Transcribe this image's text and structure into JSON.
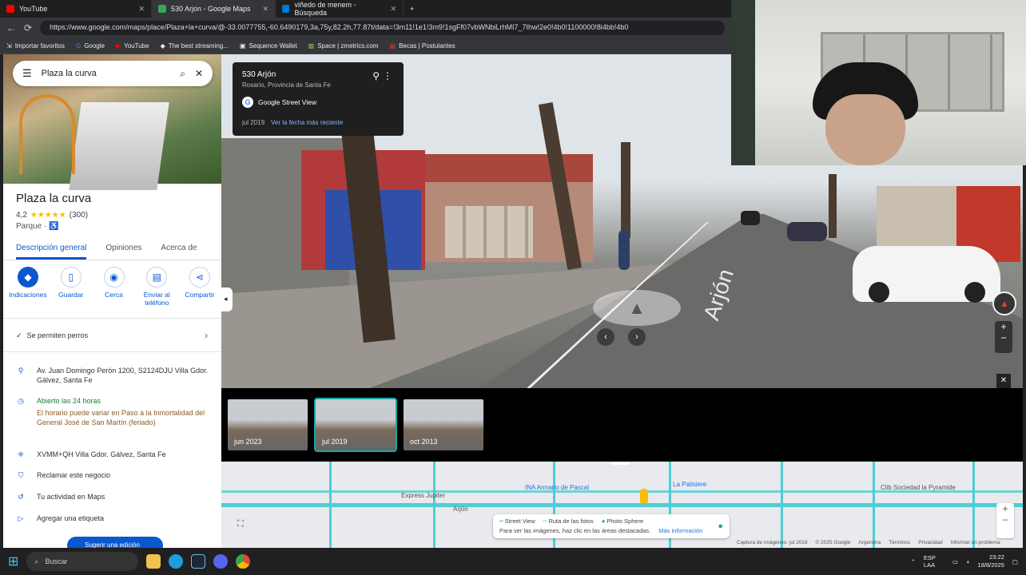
{
  "browser": {
    "tabs": [
      {
        "label": "YouTube",
        "color": "#ff0000"
      },
      {
        "label": "530 Arjon - Google Maps",
        "color": "#34a853"
      },
      {
        "label": "viñedo de menem - Búsqueda",
        "color": "#0078d4"
      }
    ],
    "url": "https://www.google.com/maps/place/Plaza+la+curva/@-33.0077755,-60.6490179,3a,75y,82.2h,77.87t/data=!3m11!1e1!3m9!1sgFf07vbWNbiLrhMI7_7Ihw!2e0!4b0!1100000!8i4bb!4b0",
    "bookmarks": [
      {
        "label": "Importar favoritos",
        "icon": "import-icon"
      },
      {
        "label": "Google",
        "icon": "google-icon"
      },
      {
        "label": "YouTube",
        "icon": "youtube-icon"
      },
      {
        "label": "The best streaming...",
        "icon": "streaming-icon"
      },
      {
        "label": "Sequence Wallet",
        "icon": "wallet-icon"
      },
      {
        "label": "Space | zmetrics.com",
        "icon": "space-icon"
      },
      {
        "label": "Becas | Postulantes",
        "icon": "becas-icon"
      }
    ]
  },
  "search": {
    "value": "Plaza la curva"
  },
  "place": {
    "name": "Plaza la curva",
    "rating": "4,2",
    "stars": "★★★★★",
    "reviews": "(300)",
    "type": "Parque · ♿",
    "tabs": [
      "Descripción general",
      "Opiniones",
      "Acerca de"
    ],
    "actions": [
      "Indicaciones",
      "Guardar",
      "Cerca",
      "Enviar al teléfono",
      "Compartir"
    ],
    "pets": "Se permiten perros",
    "address": "Av. Juan Domingo Perón 1200, S2124DJU Villa Gdor. Gálvez, Santa Fe",
    "hours_status": "Abierto las 24 horas",
    "hours_note": "El horario puede variar en Paso a la Inmortalidad del General José de San Martín (feriado)",
    "plus_code": "XVMM+QH Villa Gdor. Gálvez, Santa Fe",
    "claim": "Reclamar este negocio",
    "activity": "Tu actividad en Maps",
    "label": "Agregar una etiqueta",
    "suggest": "Sugerir una edición"
  },
  "streetview": {
    "card_title": "530 Arjón",
    "card_subtitle": "Rosario, Provincia de Santa Fe",
    "source": "Google Street View",
    "date": "jul 2019",
    "recent_link": "Ver la fecha más reciente",
    "road_label": "Arjón"
  },
  "filmstrip": [
    {
      "label": "jun 2023",
      "selected": false
    },
    {
      "label": "jul 2019",
      "selected": true
    },
    {
      "label": "oct 2013",
      "selected": false
    }
  ],
  "map": {
    "street": "Arjón",
    "pois": [
      "Express Jupiter",
      "INA Armario de Pascal",
      "La Patisiere",
      "Clib Sociedad la Pyramide"
    ],
    "legend": {
      "street_view": "Street View",
      "photos": "Ruta de las fotos",
      "sphere": "Photo Sphere",
      "hint": "Para ver las imágenes, haz clic en las áreas destacadas.",
      "more": "Más información"
    },
    "footer": [
      "Captura de imágenes: jul 2019",
      "© 2025 Google",
      "Argentina",
      "Términos",
      "Privacidad",
      "Informar un problema"
    ]
  },
  "taskbar": {
    "search": "Buscar",
    "lang": "ESP LAA",
    "time": "23:22",
    "date": "18/8/2025"
  }
}
